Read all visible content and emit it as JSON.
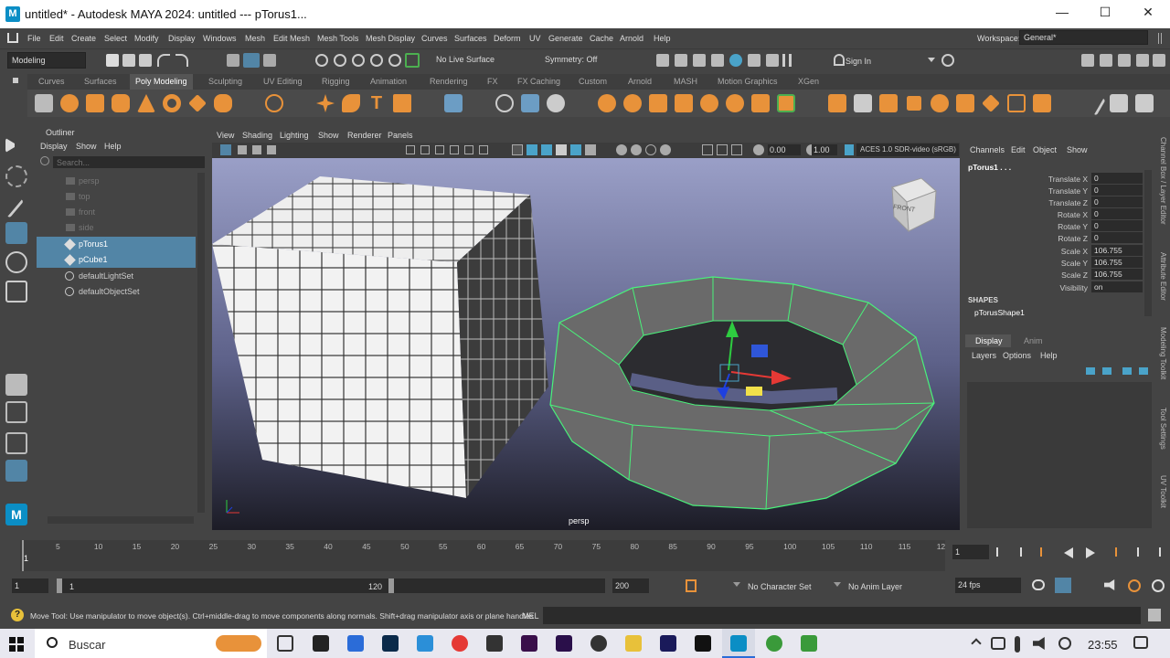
{
  "titlebar": {
    "logo": "M",
    "title": "untitled* - Autodesk MAYA 2024: untitled   ---   pTorus1...",
    "min": "—",
    "max": "☐",
    "close": "✕"
  },
  "menubar": {
    "items": [
      "File",
      "Edit",
      "Create",
      "Select",
      "Modify",
      "Display",
      "Windows",
      "Mesh",
      "Edit Mesh",
      "Mesh Tools",
      "Mesh Display",
      "Curves",
      "Surfaces",
      "Deform",
      "UV",
      "Generate",
      "Cache",
      "Arnold",
      "Help"
    ],
    "workspace_label": "Workspace:",
    "workspace_value": "General*"
  },
  "statusline": {
    "mode": "Modeling",
    "live_surface": "No Live Surface",
    "symmetry": "Symmetry: Off",
    "sign_in": "Sign In"
  },
  "shelf": {
    "tabs": [
      "Curves",
      "Surfaces",
      "Poly Modeling",
      "Sculpting",
      "UV Editing",
      "Rigging",
      "Animation",
      "Rendering",
      "FX",
      "FX Caching",
      "Custom",
      "Arnold",
      "MASH",
      "Motion Graphics",
      "XGen"
    ],
    "selected": "Poly Modeling"
  },
  "outliner": {
    "title": "Outliner",
    "menu": [
      "Display",
      "Show",
      "Help"
    ],
    "search_placeholder": "Search...",
    "items": [
      {
        "label": "persp",
        "state": "dim"
      },
      {
        "label": "top",
        "state": "dim"
      },
      {
        "label": "front",
        "state": "dim"
      },
      {
        "label": "side",
        "state": "dim"
      },
      {
        "label": "pTorus1",
        "state": "sel"
      },
      {
        "label": "pCube1",
        "state": "sel"
      },
      {
        "label": "defaultLightSet",
        "state": "normal"
      },
      {
        "label": "defaultObjectSet",
        "state": "normal"
      }
    ]
  },
  "viewport": {
    "menu": [
      "View",
      "Shading",
      "Lighting",
      "Show",
      "Renderer",
      "Panels"
    ],
    "near": "0.00",
    "far": "1.00",
    "color_space": "ACES 1.0 SDR-video (sRGB)",
    "camera": "persp",
    "viewcube": "FRONT"
  },
  "channelbox": {
    "tabs": [
      "Channels",
      "Edit",
      "Object",
      "Show"
    ],
    "object": "pTorus1 . . .",
    "attrs": [
      {
        "name": "Translate X",
        "value": "0"
      },
      {
        "name": "Translate Y",
        "value": "0"
      },
      {
        "name": "Translate Z",
        "value": "0"
      },
      {
        "name": "Rotate X",
        "value": "0"
      },
      {
        "name": "Rotate Y",
        "value": "0"
      },
      {
        "name": "Rotate Z",
        "value": "0"
      },
      {
        "name": "Scale X",
        "value": "106.755"
      },
      {
        "name": "Scale Y",
        "value": "106.755"
      },
      {
        "name": "Scale Z",
        "value": "106.755"
      },
      {
        "name": "Visibility",
        "value": "on"
      }
    ],
    "shapes_label": "SHAPES",
    "shape": "pTorusShape1"
  },
  "layers": {
    "tabs": [
      "Display",
      "Anim"
    ],
    "menu": [
      "Layers",
      "Options",
      "Help"
    ]
  },
  "sidetabs": [
    "Channel Box / Layer Editor",
    "Attribute Editor",
    "Modeling Toolkit",
    "Tool Settings",
    "UV Toolkit"
  ],
  "timeslider": {
    "ticks": [
      "5",
      "10",
      "15",
      "20",
      "25",
      "30",
      "35",
      "40",
      "45",
      "50",
      "55",
      "60",
      "65",
      "70",
      "75",
      "80",
      "85",
      "90",
      "95",
      "100",
      "105",
      "110",
      "115",
      "12"
    ],
    "start": "1",
    "current": "1"
  },
  "range": {
    "start": "1",
    "range_start": "1",
    "range_end": "120",
    "end": "200",
    "character_set": "No Character Set",
    "anim_layer": "No Anim Layer",
    "fps": "24 fps"
  },
  "helpline": {
    "text": "Move Tool: Use manipulator to move object(s). Ctrl+middle-drag to move components along normals. Shift+drag manipulator axis or plane handles",
    "mel": "MEL"
  },
  "taskbar": {
    "search": "Buscar",
    "clock": "23:55"
  }
}
